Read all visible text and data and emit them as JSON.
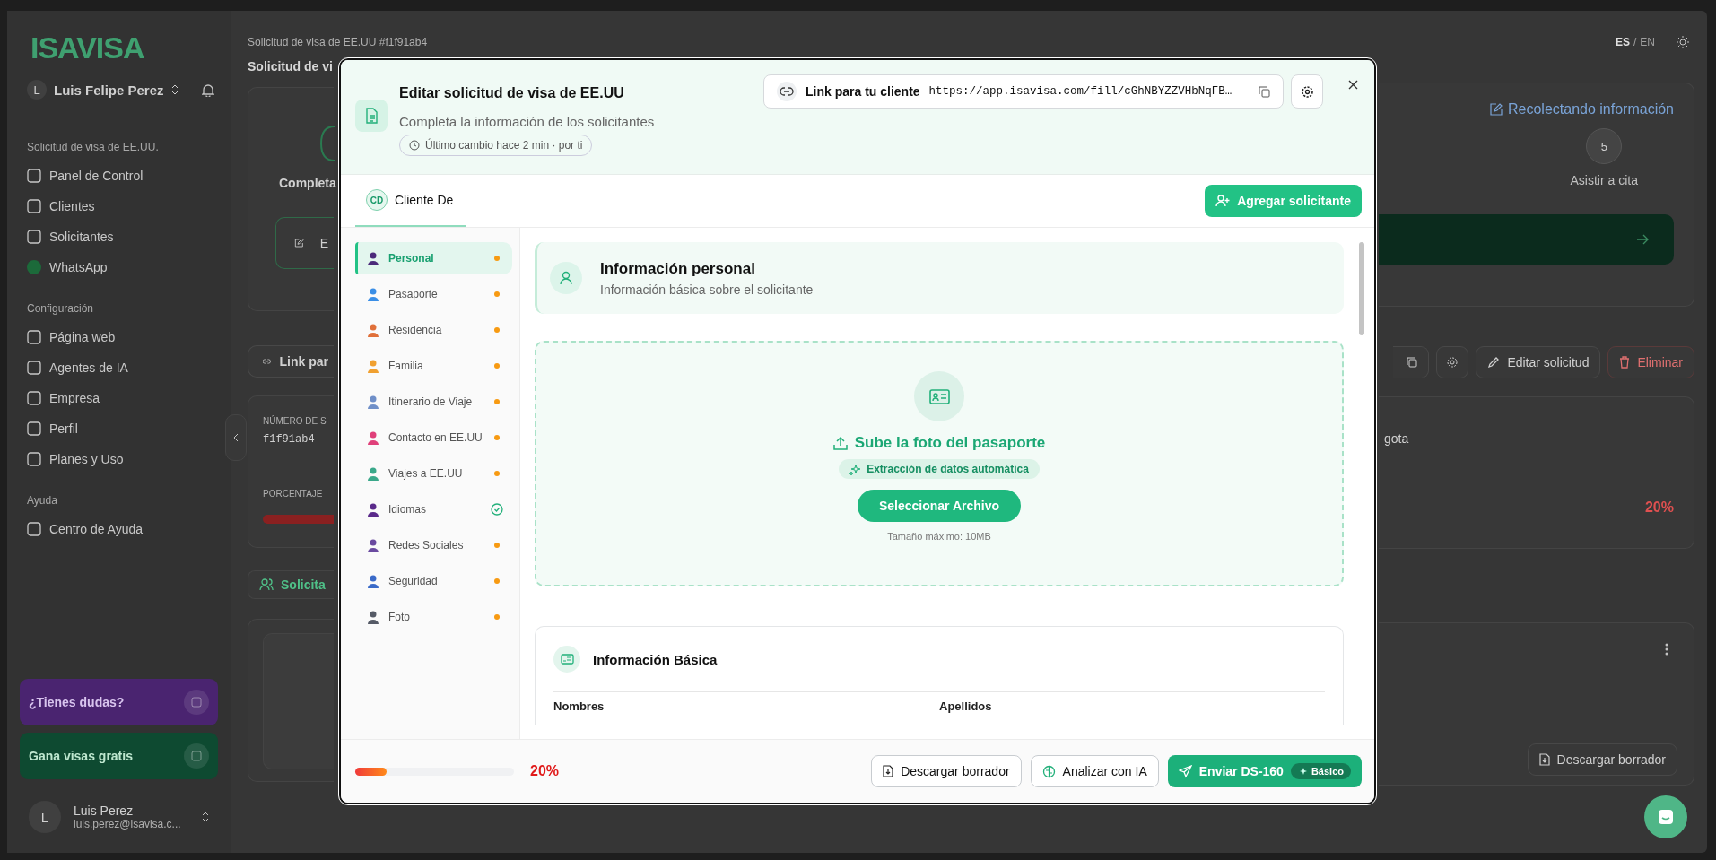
{
  "sidebar": {
    "logo": "ISAVISA",
    "account": {
      "initial": "L",
      "name": "Luis Felipe Perez"
    },
    "sections": [
      {
        "title": "Solicitud de visa de EE.UU.",
        "items": [
          {
            "label": "Panel de Control"
          },
          {
            "label": "Clientes"
          },
          {
            "label": "Solicitantes"
          },
          {
            "label": "WhatsApp"
          }
        ]
      },
      {
        "title": "Configuración",
        "items": [
          {
            "label": "Página web"
          },
          {
            "label": "Agentes de IA"
          },
          {
            "label": "Empresa"
          },
          {
            "label": "Perfil"
          },
          {
            "label": "Planes y Uso"
          }
        ]
      },
      {
        "title": "Ayuda",
        "items": [
          {
            "label": "Centro de Ayuda"
          }
        ]
      }
    ],
    "promos": [
      {
        "label": "¿Tienes dudas?",
        "color": "#4a2470"
      },
      {
        "label": "Gana visas gratis",
        "color": "#0e4a31"
      }
    ],
    "user": {
      "initial": "L",
      "name": "Luis Perez",
      "email": "luis.perez@isavisa.c..."
    }
  },
  "page": {
    "breadcrumb": "Solicitud de visa de EE.UU #f1f91ab4",
    "title": "Solicitud de vi",
    "languages": [
      {
        "label": "ES",
        "selected": true
      },
      {
        "label": "EN",
        "selected": false
      }
    ],
    "language_separator": "/",
    "step_fragment": "Completa",
    "edit_fragment": "E",
    "link_fragment": "Link par",
    "number_label": "NÚMERO DE S",
    "number": "f1f91ab4",
    "percent_label": "PORCENTAJE",
    "applicants_fragment": "Solicita",
    "status": "Recolectando información",
    "step": {
      "number": "5",
      "label": "Asistir a cita"
    },
    "edit_button": "Editar solicitud",
    "delete_button": "Eliminar",
    "city_fragment": "gota",
    "percent": "20%",
    "download_button": "Descargar borrador"
  },
  "modal": {
    "title": "Editar solicitud de visa de EE.UU",
    "subtitle": "Completa la información de los solicitantes",
    "last_change": "Último cambio hace 2 min",
    "separator": "·",
    "by": "por ti",
    "link": {
      "label": "Link para tu cliente",
      "url": "https://app.isavisa.com/fill/cGhNBYZZVHbNqFB…"
    },
    "tabs": [
      {
        "initials": "CD",
        "label": "Cliente De",
        "selected": true
      }
    ],
    "add_button": "Agregar solicitante",
    "sections": [
      {
        "label": "Personal",
        "selected": true,
        "complete": false
      },
      {
        "label": "Pasaporte",
        "selected": false,
        "complete": false
      },
      {
        "label": "Residencia",
        "selected": false,
        "complete": false
      },
      {
        "label": "Familia",
        "selected": false,
        "complete": false
      },
      {
        "label": "Itinerario de Viaje",
        "selected": false,
        "complete": false
      },
      {
        "label": "Contacto en EE.UU",
        "selected": false,
        "complete": false
      },
      {
        "label": "Viajes a EE.UU",
        "selected": false,
        "complete": false
      },
      {
        "label": "Idiomas",
        "selected": false,
        "complete": true
      },
      {
        "label": "Redes Sociales",
        "selected": false,
        "complete": false
      },
      {
        "label": "Seguridad",
        "selected": false,
        "complete": false
      },
      {
        "label": "Foto",
        "selected": false,
        "complete": false
      }
    ],
    "section_header": {
      "title": "Información personal",
      "subtitle": "Información básica sobre el solicitante"
    },
    "upload": {
      "title": "Sube la foto del pasaporte",
      "badge": "Extracción de datos automática",
      "button": "Seleccionar Archivo",
      "hint": "Tamaño máximo: 10MB"
    },
    "basic": {
      "title": "Información Básica",
      "fields": [
        "Nombres",
        "Apellidos"
      ]
    },
    "footer": {
      "progress": {
        "level": 0.2,
        "reading": "20%"
      },
      "buttons": [
        {
          "label": "Descargar borrador",
          "kind": "download"
        },
        {
          "label": "Analizar con IA",
          "kind": "analyze"
        },
        {
          "label": "Enviar DS-160",
          "kind": "send",
          "badge": "Básico"
        }
      ]
    }
  }
}
